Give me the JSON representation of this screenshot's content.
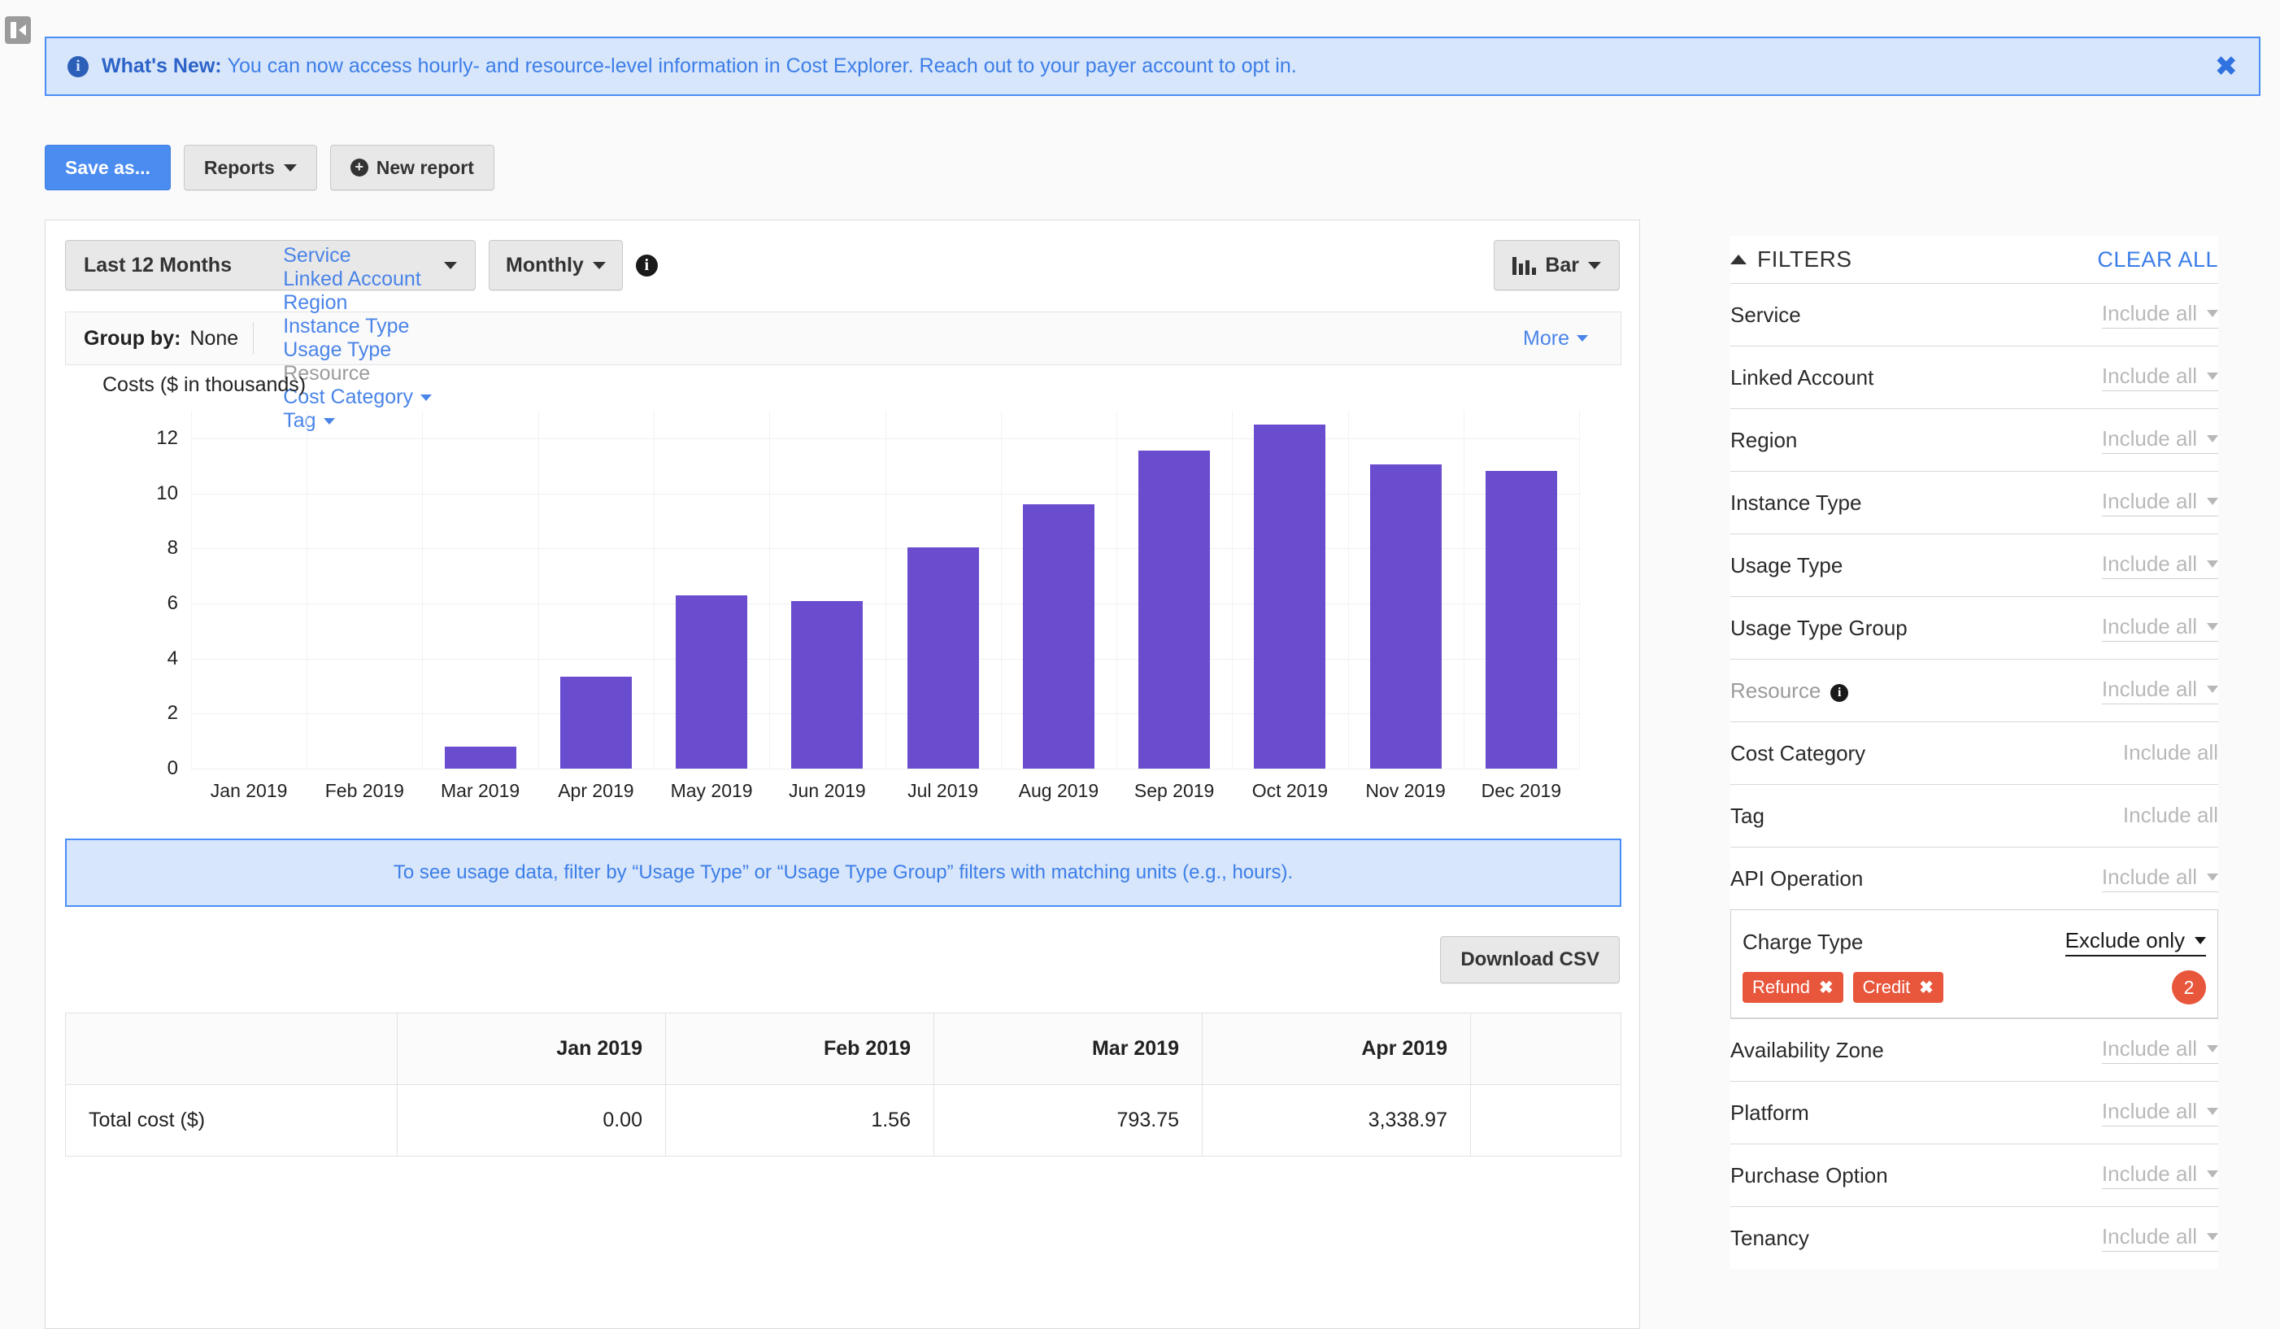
{
  "banner": {
    "icon": "info-icon",
    "strong": "What's New:",
    "text": "You can now access hourly- and resource-level information in Cost Explorer. Reach out to your payer account to opt in.",
    "close": "✖"
  },
  "toolbar": {
    "save_as": "Save as...",
    "reports": "Reports",
    "new_report": "New report"
  },
  "controls": {
    "date_range": "Last 12 Months",
    "granularity": "Monthly",
    "chart_type": "Bar"
  },
  "group_by": {
    "label": "Group by:",
    "value": "None",
    "links": [
      {
        "label": "Service",
        "caret": false,
        "disabled": false
      },
      {
        "label": "Linked Account",
        "caret": false,
        "disabled": false
      },
      {
        "label": "Region",
        "caret": false,
        "disabled": false
      },
      {
        "label": "Instance Type",
        "caret": false,
        "disabled": false
      },
      {
        "label": "Usage Type",
        "caret": false,
        "disabled": false
      },
      {
        "label": "Resource",
        "caret": false,
        "disabled": true
      },
      {
        "label": "Cost Category",
        "caret": true,
        "disabled": false
      },
      {
        "label": "Tag",
        "caret": true,
        "disabled": false
      }
    ],
    "more": "More"
  },
  "chart_data": {
    "type": "bar",
    "title": "Costs ($ in thousands)",
    "xlabel": "",
    "ylabel": "Costs ($ in thousands)",
    "categories": [
      "Jan 2019",
      "Feb 2019",
      "Mar 2019",
      "Apr 2019",
      "May 2019",
      "Jun 2019",
      "Jul 2019",
      "Aug 2019",
      "Sep 2019",
      "Oct 2019",
      "Nov 2019",
      "Dec 2019"
    ],
    "values": [
      0,
      0.0016,
      0.79,
      3.34,
      6.3,
      6.1,
      8.05,
      9.6,
      11.55,
      12.5,
      11.05,
      10.8
    ],
    "ylim": [
      0,
      13
    ],
    "yticks": [
      0,
      2,
      4,
      6,
      8,
      10,
      12
    ],
    "grid": true,
    "legend": "none",
    "bar_color": "#6a4ccf"
  },
  "usage_notice": "To see usage data, filter by “Usage Type” or “Usage Type Group” filters with matching units (e.g., hours).",
  "download_csv": "Download CSV",
  "cost_table": {
    "columns": [
      "",
      "Jan 2019",
      "Feb 2019",
      "Mar 2019",
      "Apr 2019",
      ""
    ],
    "rows": [
      {
        "label": "Total cost ($)",
        "values": [
          "0.00",
          "1.56",
          "793.75",
          "3,338.97",
          ""
        ]
      }
    ]
  },
  "filters": {
    "title": "FILTERS",
    "clear_all": "CLEAR ALL",
    "rows": [
      {
        "name": "Service",
        "value": "Include all",
        "caret": true,
        "muted_name": false,
        "info": false
      },
      {
        "name": "Linked Account",
        "value": "Include all",
        "caret": true,
        "muted_name": false,
        "info": false
      },
      {
        "name": "Region",
        "value": "Include all",
        "caret": true,
        "muted_name": false,
        "info": false
      },
      {
        "name": "Instance Type",
        "value": "Include all",
        "caret": true,
        "muted_name": false,
        "info": false
      },
      {
        "name": "Usage Type",
        "value": "Include all",
        "caret": true,
        "muted_name": false,
        "info": false
      },
      {
        "name": "Usage Type Group",
        "value": "Include all",
        "caret": true,
        "muted_name": false,
        "info": false
      },
      {
        "name": "Resource",
        "value": "Include all",
        "caret": true,
        "muted_name": true,
        "info": true
      },
      {
        "name": "Cost Category",
        "value": "Include all",
        "caret": false,
        "muted_name": false,
        "info": false
      },
      {
        "name": "Tag",
        "value": "Include all",
        "caret": false,
        "muted_name": false,
        "info": false
      },
      {
        "name": "API Operation",
        "value": "Include all",
        "caret": true,
        "muted_name": false,
        "info": false
      }
    ],
    "charge_type": {
      "name": "Charge Type",
      "value": "Exclude only",
      "tags": [
        "Refund",
        "Credit"
      ],
      "count": "2"
    },
    "rows_after": [
      {
        "name": "Availability Zone",
        "value": "Include all",
        "caret": true,
        "muted_name": false,
        "info": false
      },
      {
        "name": "Platform",
        "value": "Include all",
        "caret": true,
        "muted_name": false,
        "info": false
      },
      {
        "name": "Purchase Option",
        "value": "Include all",
        "caret": true,
        "muted_name": false,
        "info": false
      },
      {
        "name": "Tenancy",
        "value": "Include all",
        "caret": true,
        "muted_name": false,
        "info": false
      }
    ]
  }
}
